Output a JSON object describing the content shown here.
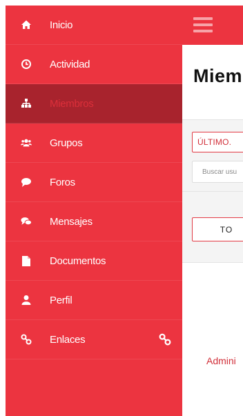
{
  "colors": {
    "accent": "#ec3440",
    "active": "#a8232d",
    "text_accent": "#d12e38"
  },
  "sidebar": {
    "items": [
      {
        "label": "Inicio",
        "icon": "home-icon"
      },
      {
        "label": "Actividad",
        "icon": "clock-icon"
      },
      {
        "label": "Miembros",
        "icon": "sitemap-icon",
        "active": true
      },
      {
        "label": "Grupos",
        "icon": "group-icon"
      },
      {
        "label": "Foros",
        "icon": "chat-bubble-icon"
      },
      {
        "label": "Mensajes",
        "icon": "comments-icon"
      },
      {
        "label": "Documentos",
        "icon": "document-icon"
      },
      {
        "label": "Perfil",
        "icon": "user-icon"
      },
      {
        "label": "Enlaces",
        "icon": "link-icon",
        "trailing_icon": "link-icon"
      }
    ]
  },
  "main": {
    "title": "Miem",
    "tab_label": "ÚLTIMO.",
    "search_placeholder": "Buscar usu",
    "filter_label": "TO",
    "admin_link": "Admini"
  }
}
